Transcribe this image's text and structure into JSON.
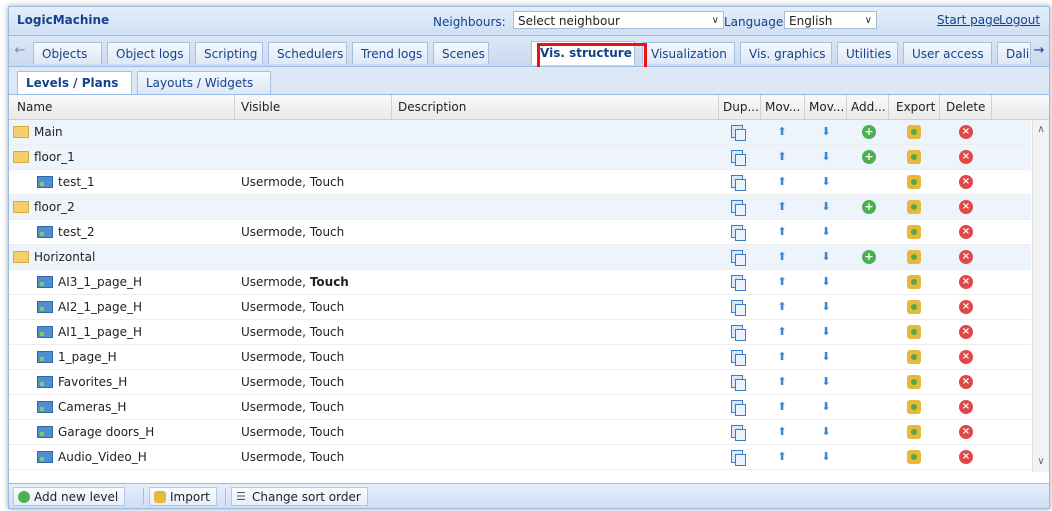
{
  "app": {
    "title": "LogicMachine"
  },
  "top": {
    "neighbours_label": "Neighbours:",
    "neighbours_value": "Select neighbour",
    "language_label": "Language:",
    "language_value": "English",
    "start_page": "Start page",
    "logout": "Logout"
  },
  "tabs": [
    {
      "label": "Objects"
    },
    {
      "label": "Object logs"
    },
    {
      "label": "Scripting"
    },
    {
      "label": "Schedulers"
    },
    {
      "label": "Trend logs"
    },
    {
      "label": "Scenes"
    },
    {
      "label": "Vis. structure"
    },
    {
      "label": "Visualization"
    },
    {
      "label": "Vis. graphics"
    },
    {
      "label": "Utilities"
    },
    {
      "label": "User access"
    },
    {
      "label": "Dali"
    }
  ],
  "subtabs": [
    {
      "label": "Levels / Plans"
    },
    {
      "label": "Layouts / Widgets"
    }
  ],
  "columns": {
    "name": "Name",
    "visible": "Visible",
    "description": "Description",
    "duplicate": "Dup...",
    "move_up": "Mov...",
    "move_down": "Mov...",
    "add": "Add...",
    "export": "Export",
    "delete": "Delete"
  },
  "rows": [
    {
      "name": "Main",
      "visible": "",
      "touch": "",
      "type": "level",
      "add": true
    },
    {
      "name": "floor_1",
      "visible": "",
      "touch": "",
      "type": "level",
      "add": true
    },
    {
      "name": "test_1",
      "visible": "Usermode, ",
      "touch": "Touch",
      "type": "plan",
      "add": false
    },
    {
      "name": "floor_2",
      "visible": "",
      "touch": "",
      "type": "level",
      "add": true
    },
    {
      "name": "test_2",
      "visible": "Usermode, ",
      "touch": "Touch",
      "type": "plan",
      "add": false
    },
    {
      "name": "Horizontal",
      "visible": "",
      "touch": "",
      "type": "level",
      "add": true
    },
    {
      "name": "AI3_1_page_H",
      "visible": "Usermode, ",
      "touch": "Touch",
      "type": "plan",
      "add": false,
      "bold_touch": true
    },
    {
      "name": "AI2_1_page_H",
      "visible": "Usermode, ",
      "touch": "Touch",
      "type": "plan",
      "add": false
    },
    {
      "name": "AI1_1_page_H",
      "visible": "Usermode, ",
      "touch": "Touch",
      "type": "plan",
      "add": false
    },
    {
      "name": "1_page_H",
      "visible": "Usermode, ",
      "touch": "Touch",
      "type": "plan",
      "add": false
    },
    {
      "name": "Favorites_H",
      "visible": "Usermode, ",
      "touch": "Touch",
      "type": "plan",
      "add": false
    },
    {
      "name": "Cameras_H",
      "visible": "Usermode, ",
      "touch": "Touch",
      "type": "plan",
      "add": false
    },
    {
      "name": "Garage doors_H",
      "visible": "Usermode, ",
      "touch": "Touch",
      "type": "plan",
      "add": false
    },
    {
      "name": "Audio_Video_H",
      "visible": "Usermode, ",
      "touch": "Touch",
      "type": "plan",
      "add": false
    }
  ],
  "bottom": {
    "add_level": "Add new level",
    "import": "Import",
    "change_sort": "Change sort order"
  },
  "colors": {
    "accent": "#15428b",
    "highlight": "#e11111",
    "row_alt": "#eef4fc"
  }
}
